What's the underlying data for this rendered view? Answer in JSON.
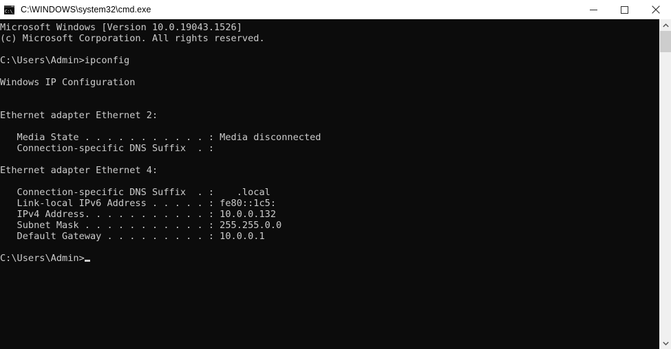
{
  "window": {
    "title": "C:\\WINDOWS\\system32\\cmd.exe",
    "icon": "cmd-icon",
    "background_color": "#0c0c0c",
    "text_color": "#cccccc",
    "titlebar_color": "#ffffff"
  },
  "window_controls": {
    "minimize_label": "Minimize",
    "maximize_label": "Maximize",
    "close_label": "Close"
  },
  "terminal": {
    "content": "Microsoft Windows [Version 10.0.19043.1526]\n(c) Microsoft Corporation. All rights reserved.\n\nC:\\Users\\Admin>ipconfig\n\nWindows IP Configuration\n\n\nEthernet adapter Ethernet 2:\n\n   Media State . . . . . . . . . . . : Media disconnected\n   Connection-specific DNS Suffix  . :\n\nEthernet adapter Ethernet 4:\n\n   Connection-specific DNS Suffix  . :    .local\n   Link-local IPv6 Address . . . . . : fe80::1c5:\n   IPv4 Address. . . . . . . . . . . : 10.0.0.132\n   Subnet Mask . . . . . . . . . . . : 255.255.0.0\n   Default Gateway . . . . . . . . . : 10.0.0.1\n\nC:\\Users\\Admin>",
    "lines": [
      "Microsoft Windows [Version 10.0.19043.1526]",
      "(c) Microsoft Corporation. All rights reserved.",
      "",
      "C:\\Users\\Admin>ipconfig",
      "",
      "Windows IP Configuration",
      "",
      "",
      "Ethernet adapter Ethernet 2:",
      "",
      "   Media State . . . . . . . . . . . : Media disconnected",
      "   Connection-specific DNS Suffix  . :",
      "",
      "Ethernet adapter Ethernet 4:",
      "",
      "   Connection-specific DNS Suffix  . :    .local",
      "   Link-local IPv6 Address . . . . . : fe80::1c5:",
      "   IPv4 Address. . . . . . . . . . . : 10.0.0.132",
      "   Subnet Mask . . . . . . . . . . . : 255.255.0.0",
      "   Default Gateway . . . . . . . . . : 10.0.0.1",
      "",
      "C:\\Users\\Admin>"
    ],
    "os_version": "10.0.19043.1526",
    "copyright": "(c) Microsoft Corporation. All rights reserved.",
    "command": "ipconfig",
    "prompt": "C:\\Users\\Admin>",
    "section_title": "Windows IP Configuration",
    "adapters": [
      {
        "name": "Ethernet adapter Ethernet 2:",
        "fields": [
          {
            "label": "Media State",
            "value": "Media disconnected"
          },
          {
            "label": "Connection-specific DNS Suffix",
            "value": ""
          }
        ]
      },
      {
        "name": "Ethernet adapter Ethernet 4:",
        "fields": [
          {
            "label": "Connection-specific DNS Suffix",
            "value": ".local"
          },
          {
            "label": "Link-local IPv6 Address",
            "value": "fe80::1c5:"
          },
          {
            "label": "IPv4 Address",
            "value": "10.0.0.132"
          },
          {
            "label": "Subnet Mask",
            "value": "255.255.0.0"
          },
          {
            "label": "Default Gateway",
            "value": "10.0.0.1"
          }
        ]
      }
    ]
  },
  "scrollbar": {
    "up_arrow": "chevron-up-icon",
    "down_arrow": "chevron-down-icon",
    "thumb_position": "top"
  }
}
